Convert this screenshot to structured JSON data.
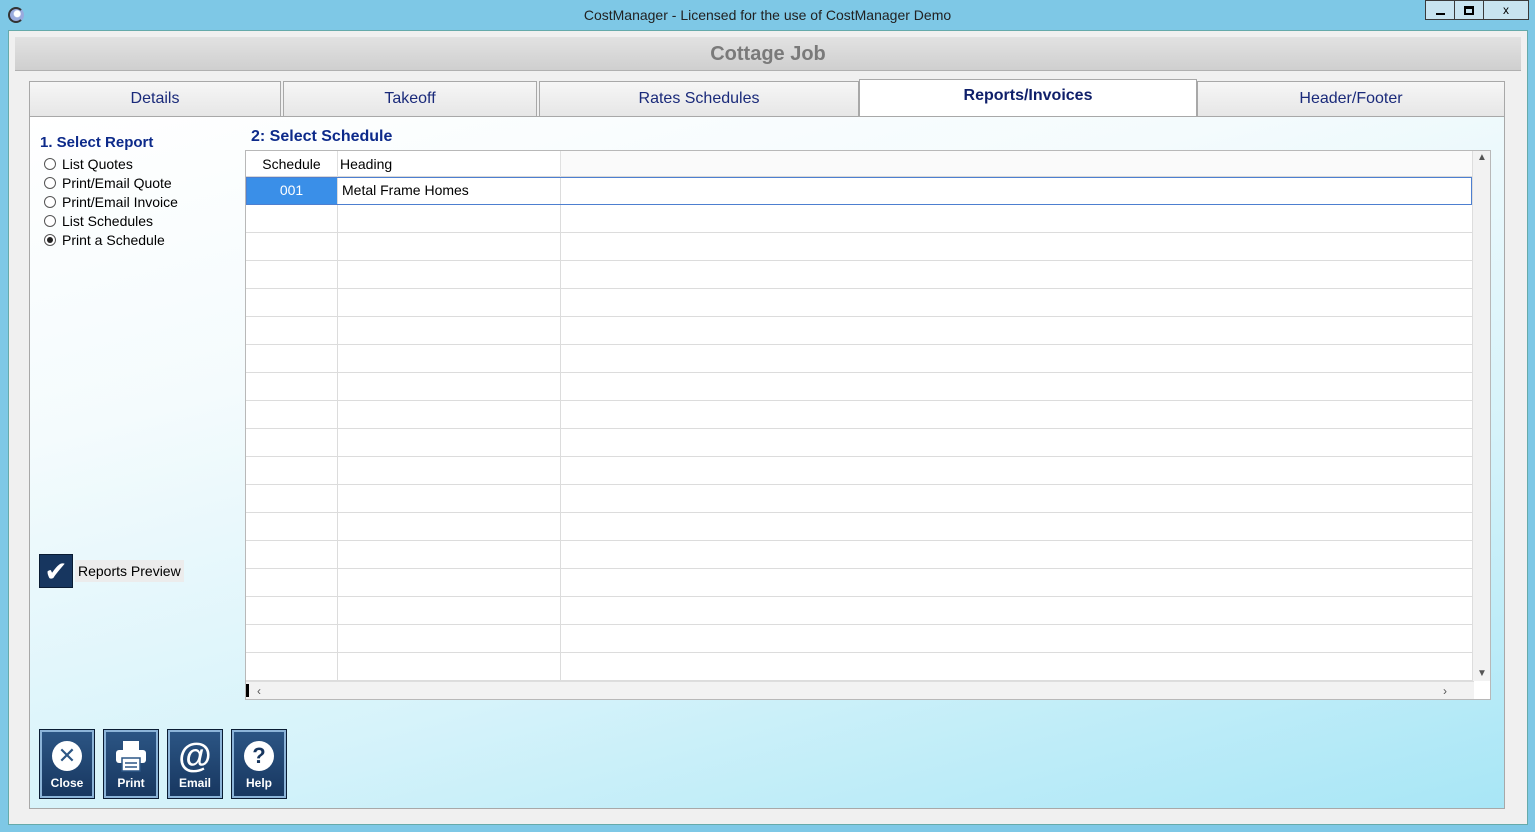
{
  "window": {
    "title": "CostManager - Licensed for the use of CostManager Demo",
    "minimize_icon": "minimize-icon",
    "maximize_icon": "maximize-icon",
    "close_glyph": "x"
  },
  "job": {
    "title": "Cottage Job"
  },
  "tabs": [
    {
      "label": "Details"
    },
    {
      "label": "Takeoff"
    },
    {
      "label": "Rates Schedules"
    },
    {
      "label": "Reports/Invoices",
      "active": true
    },
    {
      "label": "Header/Footer"
    }
  ],
  "reports": {
    "heading": "1. Select Report",
    "options": [
      {
        "label": "List Quotes",
        "checked": false
      },
      {
        "label": "Print/Email Quote",
        "checked": false
      },
      {
        "label": "Print/Email Invoice",
        "checked": false
      },
      {
        "label": "List Schedules",
        "checked": false
      },
      {
        "label": "Print a Schedule",
        "checked": true
      }
    ],
    "preview_label": "Reports Preview",
    "preview_checked": true
  },
  "schedule": {
    "heading": "2: Select Schedule",
    "columns": [
      "Schedule",
      "Heading"
    ],
    "rows": [
      {
        "schedule": "001",
        "heading": "Metal Frame Homes",
        "selected": true
      }
    ]
  },
  "toolbar": {
    "close_label": "Close",
    "print_label": "Print",
    "email_label": "Email",
    "help_label": "Help",
    "close_glyph": "✕",
    "email_glyph": "@",
    "help_glyph": "?"
  },
  "colors": {
    "accent": "#17365f",
    "selection": "#3a8fe8",
    "tab_text": "#1a2a7a",
    "section_text": "#0d2a8a"
  }
}
